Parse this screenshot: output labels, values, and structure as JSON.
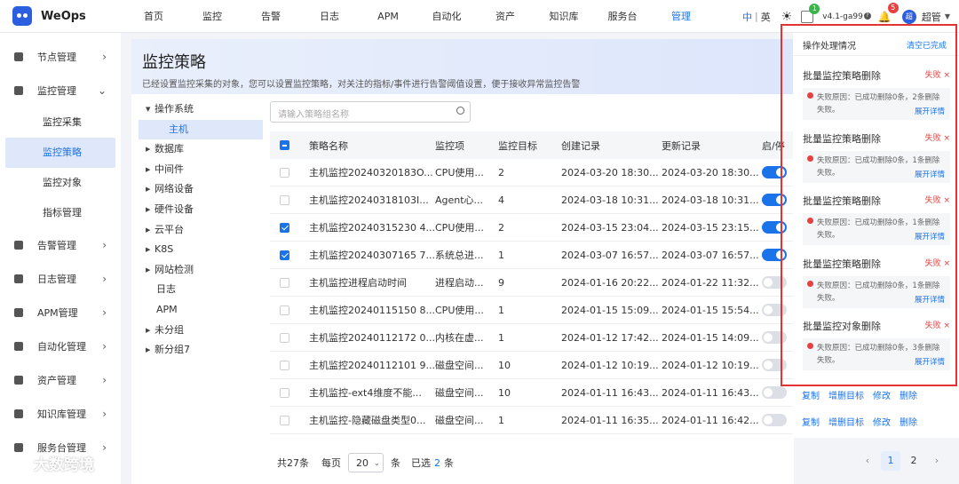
{
  "app": {
    "name": "WeOps"
  },
  "nav": [
    "首页",
    "监控",
    "告警",
    "日志",
    "APM",
    "自动化",
    "资产",
    "知识库",
    "服务台",
    "管理"
  ],
  "top": {
    "lang_active": "中",
    "lang_sep": "|",
    "lang_other": "英",
    "version": "v4.1-ga99",
    "notif_count_a": "1",
    "notif_count_b": "5",
    "user": "超管",
    "avatar_letter": "超"
  },
  "sidebar": [
    {
      "label": "节点管理"
    },
    {
      "label": "监控管理"
    },
    {
      "label": "监控采集"
    },
    {
      "label": "监控策略"
    },
    {
      "label": "监控对象"
    },
    {
      "label": "指标管理"
    },
    {
      "label": "告警管理"
    },
    {
      "label": "日志管理"
    },
    {
      "label": "APM管理"
    },
    {
      "label": "自动化管理"
    },
    {
      "label": "资产管理"
    },
    {
      "label": "知识库管理"
    },
    {
      "label": "服务台管理"
    }
  ],
  "page": {
    "title": "监控策略",
    "desc": "已经设置监控采集的对象，您可以设置监控策略，对关注的指标/事件进行告警阈值设置，便于接收异常监控告警"
  },
  "tree": [
    "操作系统",
    "主机",
    "数据库",
    "中间件",
    "网络设备",
    "硬件设备",
    "云平台",
    "K8S",
    "网站检测",
    "日志",
    "APM",
    "未分组",
    "新分组7"
  ],
  "search": {
    "placeholder": "请输入策略组名称"
  },
  "table": {
    "headers": [
      "策略名称",
      "监控项",
      "监控目标",
      "创建记录",
      "更新记录",
      "启/停"
    ],
    "rows": [
      {
        "name": "主机监控20240320183O...",
        "item": "CPU使用...",
        "target": "2",
        "created": "2024-03-20 18:30...",
        "updated": "2024-03-20 18:30...",
        "on": true,
        "checked": false
      },
      {
        "name": "主机监控20240318103I...",
        "item": "Agent心...",
        "target": "4",
        "created": "2024-03-18 10:31...",
        "updated": "2024-03-18 10:31...",
        "on": true,
        "checked": false
      },
      {
        "name": "主机监控20240315230 4...",
        "item": "CPU使用...",
        "target": "2",
        "created": "2024-03-15 23:04...",
        "updated": "2024-03-15 23:15...",
        "on": true,
        "checked": true
      },
      {
        "name": "主机监控20240307165 7...",
        "item": "系统总进...",
        "target": "1",
        "created": "2024-03-07 16:57...",
        "updated": "2024-03-07 16:57...",
        "on": true,
        "checked": true
      },
      {
        "name": "主机监控进程启动时间",
        "item": "进程启动...",
        "target": "9",
        "created": "2024-01-16 20:22...",
        "updated": "2024-01-22 11:32...",
        "on": false,
        "checked": false
      },
      {
        "name": "主机监控20240115150 8...",
        "item": "CPU使用...",
        "target": "1",
        "created": "2024-01-15 15:09...",
        "updated": "2024-01-15 15:54...",
        "on": false,
        "checked": false
      },
      {
        "name": "主机监控20240112172 0...",
        "item": "内核在虚...",
        "target": "1",
        "created": "2024-01-12 17:42...",
        "updated": "2024-01-15 14:09...",
        "on": false,
        "checked": false
      },
      {
        "name": "主机监控20240112101 9...",
        "item": "磁盘空间...",
        "target": "10",
        "created": "2024-01-12 10:19...",
        "updated": "2024-01-12 10:19...",
        "on": false,
        "checked": false
      },
      {
        "name": "主机监控-ext4维度不能...",
        "item": "磁盘空间...",
        "target": "10",
        "created": "2024-01-11 16:43...",
        "updated": "2024-01-11 16:43...",
        "on": false,
        "checked": false
      },
      {
        "name": "主机监控-隐藏磁盘类型0...",
        "item": "磁盘空间...",
        "target": "1",
        "created": "2024-01-11 16:35...",
        "updated": "2024-01-11 16:42...",
        "on": false,
        "checked": false
      }
    ]
  },
  "footer": {
    "total": "共27条",
    "per_page_label": "每页",
    "page_size": "20",
    "unit": "条",
    "selected_label": "已选",
    "selected_count": "2",
    "selected_unit": "条"
  },
  "pager": {
    "pages": [
      "1",
      "2"
    ],
    "current": "1"
  },
  "actions": {
    "copy": "复制",
    "add_del": "增删目标",
    "edit": "修改",
    "delete": "删除"
  },
  "panel": {
    "title": "操作处理情况",
    "clear": "清空已完成",
    "cards": [
      {
        "title": "批量监控策略删除",
        "status": "失败 ×",
        "msg": "失败原因：已成功删除0条，2条删除失败。",
        "link": "展开详情"
      },
      {
        "title": "批量监控策略删除",
        "status": "失败 ×",
        "msg": "失败原因：已成功删除0条，1条删除失败。",
        "link": "展开详情"
      },
      {
        "title": "批量监控策略删除",
        "status": "失败 ×",
        "msg": "失败原因：已成功删除0条，1条删除失败。",
        "link": "展开详情"
      },
      {
        "title": "批量监控策略删除",
        "status": "失败 ×",
        "msg": "失败原因：已成功删除0条，1条删除失败。",
        "link": "展开详情"
      },
      {
        "title": "批量监控对象删除",
        "status": "失败 ×",
        "msg": "失败原因：已成功删除0条，3条删除失败。",
        "link": "展开详情"
      }
    ]
  },
  "watermark": "大数跨境",
  "colors": {
    "primary": "#1a73e8",
    "danger": "#e84040",
    "highlight": "#e53232"
  }
}
